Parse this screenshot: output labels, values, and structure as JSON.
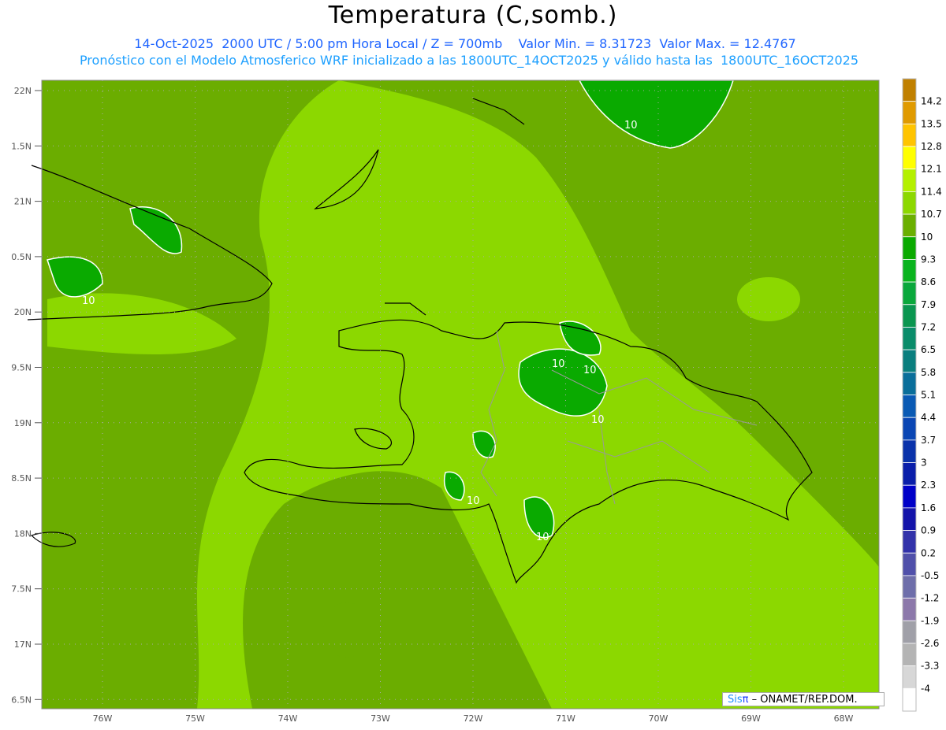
{
  "header": {
    "title": "Temperatura (C,somb.)",
    "line1": "14-Oct-2025  2000 UTC / 5:00 pm Hora Local / Z = 700mb    Valor Min. = 8.31723  Valor Max. = 12.4767",
    "line2": "Pronóstico con el Modelo Atmosferico WRF inicializado a las 1800UTC_14OCT2025 y válido hasta las  1800UTC_16OCT2025"
  },
  "map": {
    "lat_labels": [
      "22N",
      "1.5N",
      "21N",
      "0.5N",
      "20N",
      "9.5N",
      "19N",
      "8.5N",
      "18N",
      "7.5N",
      "17N",
      "6.5N"
    ],
    "lon_labels": [
      "76W",
      "75W",
      "74W",
      "73W",
      "72W",
      "71W",
      "70W",
      "69W",
      "68W"
    ],
    "contour_label": "10",
    "colors": {
      "base": "#6bad00",
      "light": "#8cd800",
      "dark": "#0aaa00"
    }
  },
  "colorbar": {
    "labels": [
      "14.2",
      "13.5",
      "12.8",
      "12.1",
      "11.4",
      "10.7",
      "10",
      "9.3",
      "8.6",
      "7.9",
      "7.2",
      "6.5",
      "5.8",
      "5.1",
      "4.4",
      "3.7",
      "3",
      "2.3",
      "1.6",
      "0.9",
      "0.2",
      "-0.5",
      "-1.2",
      "-1.9",
      "-2.6",
      "-3.3",
      "-4"
    ],
    "colors": [
      "#c08000",
      "#e09a00",
      "#ffc400",
      "#ffff00",
      "#b4f000",
      "#8cd800",
      "#6aaf00",
      "#0aaa00",
      "#0ab41e",
      "#0aa83c",
      "#0a9650",
      "#0a8c6a",
      "#0a7e7e",
      "#0a6e9a",
      "#0a5ab4",
      "#0a46b4",
      "#0a32aa",
      "#0a1eaa",
      "#0000c8",
      "#1414aa",
      "#3232aa",
      "#5050aa",
      "#6e6eaa",
      "#8c78aa",
      "#a0a0a8",
      "#b4b4b4",
      "#d7d7d7",
      "#ffffff"
    ]
  },
  "credit": {
    "sis": "Sis",
    "pi": "π",
    "rest": " – ONAMET/REP.DOM."
  }
}
